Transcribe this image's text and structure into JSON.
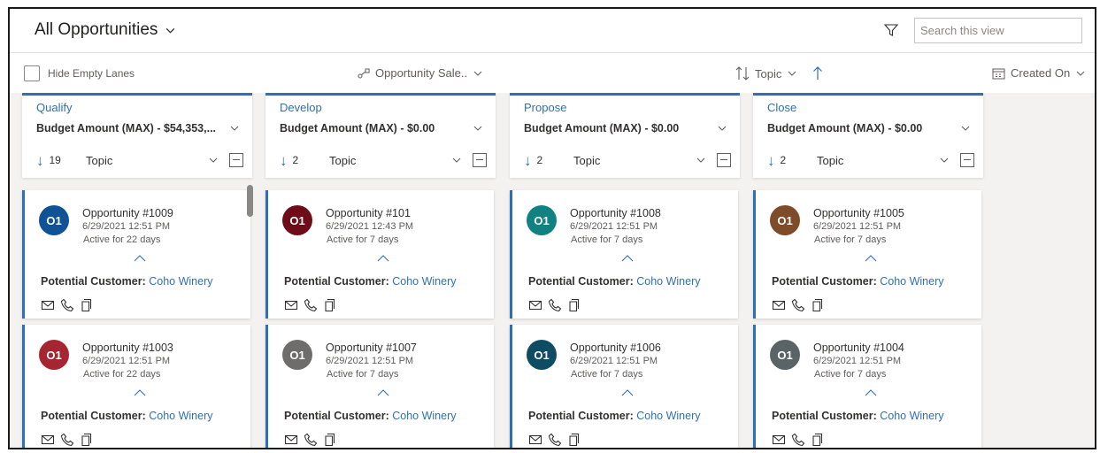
{
  "header": {
    "view_title": "All Opportunities",
    "search_placeholder": "Search this view",
    "icons": {
      "filter": "filter-icon",
      "search": "search-icon",
      "view_chevron": "chevron-down-icon"
    }
  },
  "toolbar": {
    "hide_empty_label": "Hide Empty Lanes",
    "hide_empty_checked": false,
    "process_label": "Opportunity Sale..",
    "sort_label": "Topic",
    "created_on_label": "Created On"
  },
  "colors": {
    "accent": "#2f6fb5",
    "avatars": [
      "#0f5296",
      "#6e0d19",
      "#108281",
      "#7e4c29",
      "#a52530",
      "#6f6d6c",
      "#0d4c62",
      "#5a6366"
    ]
  },
  "lanes": [
    {
      "stage": "Qualify",
      "budget": "Budget Amount (MAX) - $54,353,...",
      "count": "19",
      "sort_field": "Topic",
      "cards": [
        {
          "initials": "O1",
          "title": "Opportunity #1009",
          "date": "6/29/2021 12:51 PM",
          "active": "Active for 22 days",
          "customer_label": "Potential Customer:",
          "customer": "Coho Winery"
        },
        {
          "initials": "O1",
          "title": "Opportunity #1003",
          "date": "6/29/2021 12:51 PM",
          "active": "Active for 22 days",
          "customer_label": "Potential Customer:",
          "customer": "Coho Winery"
        }
      ]
    },
    {
      "stage": "Develop",
      "budget": "Budget Amount (MAX) - $0.00",
      "count": "2",
      "sort_field": "Topic",
      "cards": [
        {
          "initials": "O1",
          "title": "Opportunity #101",
          "date": "6/29/2021 12:43 PM",
          "active": "Active for 7 days",
          "customer_label": "Potential Customer:",
          "customer": "Coho Winery"
        },
        {
          "initials": "O1",
          "title": "Opportunity #1007",
          "date": "6/29/2021 12:51 PM",
          "active": "Active for 7 days",
          "customer_label": "Potential Customer:",
          "customer": "Coho Winery"
        }
      ]
    },
    {
      "stage": "Propose",
      "budget": "Budget Amount (MAX) - $0.00",
      "count": "2",
      "sort_field": "Topic",
      "cards": [
        {
          "initials": "O1",
          "title": "Opportunity #1008",
          "date": "6/29/2021 12:51 PM",
          "active": "Active for 7 days",
          "customer_label": "Potential Customer:",
          "customer": "Coho Winery"
        },
        {
          "initials": "O1",
          "title": "Opportunity #1006",
          "date": "6/29/2021 12:51 PM",
          "active": "Active for 7 days",
          "customer_label": "Potential Customer:",
          "customer": "Coho Winery"
        }
      ]
    },
    {
      "stage": "Close",
      "budget": "Budget Amount (MAX) - $0.00",
      "count": "2",
      "sort_field": "Topic",
      "cards": [
        {
          "initials": "O1",
          "title": "Opportunity #1005",
          "date": "6/29/2021 12:51 PM",
          "active": "Active for 7 days",
          "customer_label": "Potential Customer:",
          "customer": "Coho Winery"
        },
        {
          "initials": "O1",
          "title": "Opportunity #1004",
          "date": "6/29/2021 12:51 PM",
          "active": "Active for 7 days",
          "customer_label": "Potential Customer:",
          "customer": "Coho Winery"
        }
      ]
    }
  ]
}
